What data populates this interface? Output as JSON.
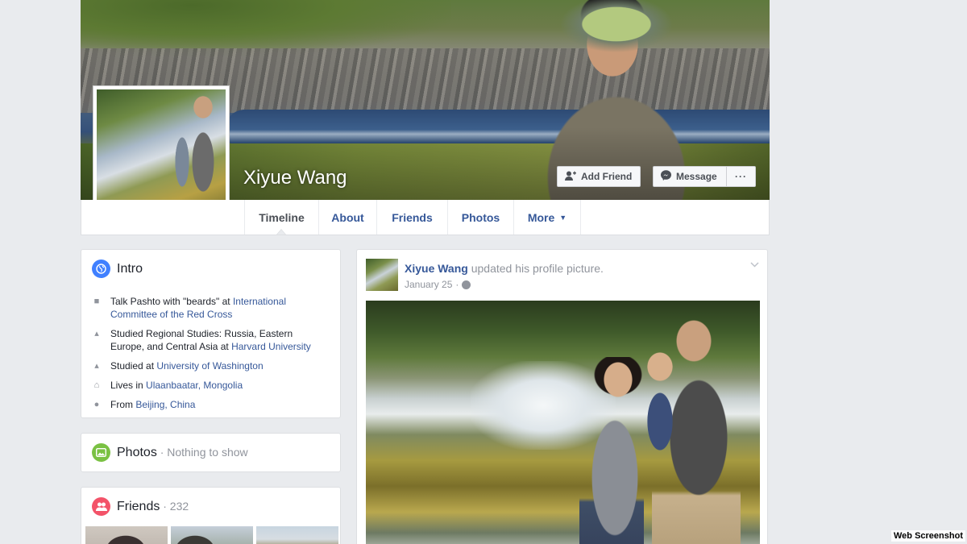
{
  "profile": {
    "name": "Xiyue Wang",
    "add_friend_label": "Add Friend",
    "message_label": "Message",
    "more_label": "···"
  },
  "tabs": [
    {
      "label": "Timeline",
      "active": true
    },
    {
      "label": "About"
    },
    {
      "label": "Friends"
    },
    {
      "label": "Photos"
    },
    {
      "label": "More",
      "caret": "▼"
    }
  ],
  "intro": {
    "title": "Intro",
    "items": [
      {
        "icon": "briefcase-icon",
        "text": "Talk Pashto with \"beards\" at ",
        "link": "International Committee of the Red Cross"
      },
      {
        "icon": "graduation-cap-icon",
        "text": "Studied Regional Studies: Russia, Eastern Europe, and Central Asia at ",
        "link": "Harvard University"
      },
      {
        "icon": "graduation-cap-icon",
        "text": "Studied at ",
        "link": "University of Washington"
      },
      {
        "icon": "home-icon",
        "text": "Lives in ",
        "link": "Ulaanbaatar, Mongolia"
      },
      {
        "icon": "location-pin-icon",
        "text": "From ",
        "link": "Beijing, China"
      }
    ]
  },
  "photos_card": {
    "title": "Photos",
    "subtitle": " · Nothing to show"
  },
  "friends_card": {
    "title": "Friends",
    "count": " · 232"
  },
  "post": {
    "author": "Xiyue Wang",
    "action": " updated his profile picture.",
    "date": "January 25",
    "separator": "·"
  },
  "watermark": "Web Screenshot",
  "colors": {
    "link": "#365899",
    "intro_icon": "#4080ff",
    "photos_icon": "#7ac143",
    "friends_icon": "#f35369"
  }
}
